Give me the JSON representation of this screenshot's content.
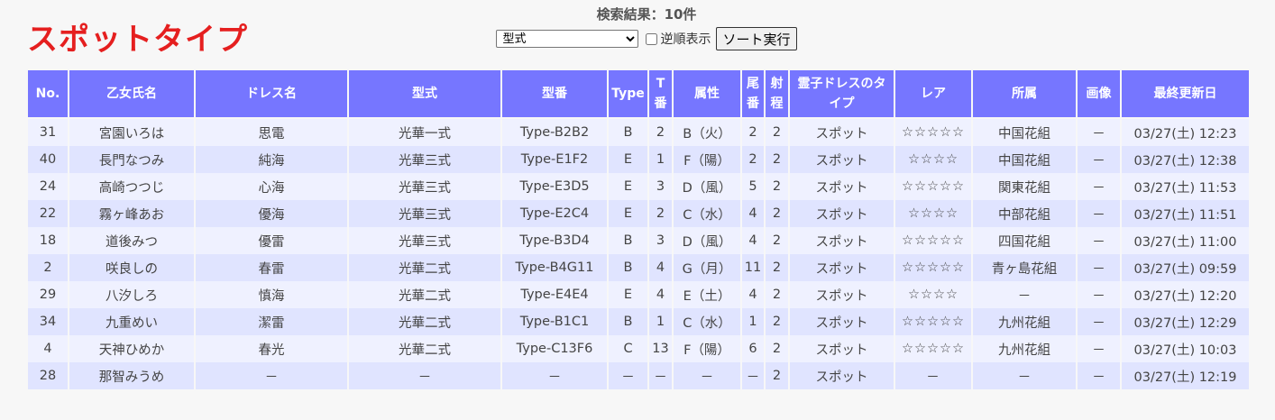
{
  "page": {
    "title": "スポットタイプ",
    "result_count": "検索結果：10件",
    "sort": {
      "selected": "型式",
      "reverse_label": "逆順表示",
      "reverse_checked": false,
      "button_label": "ソート実行"
    }
  },
  "table": {
    "headers": {
      "no": "No.",
      "name": "乙女氏名",
      "dress": "ドレス名",
      "model": "型式",
      "code": "型番",
      "type": "Type",
      "t": "T番",
      "attr": "属性",
      "tail": "尾番",
      "range": "射程",
      "dress_type": "霊子ドレスのタイプ",
      "rarity": "レア",
      "affiliation": "所属",
      "image": "画像",
      "updated": "最終更新日"
    },
    "rows": [
      {
        "no": "31",
        "name": "宮園いろは",
        "dress": "思電",
        "model": "光華一式",
        "code": "Type-B2B2",
        "type": "B",
        "t": "2",
        "attr": "B（火）",
        "tail": "2",
        "range": "2",
        "dress_type": "スポット",
        "rarity": "☆☆☆☆☆",
        "affiliation": "中国花組",
        "image": "－",
        "updated": "03/27(土) 12:23"
      },
      {
        "no": "40",
        "name": "長門なつみ",
        "dress": "純海",
        "model": "光華三式",
        "code": "Type-E1F2",
        "type": "E",
        "t": "1",
        "attr": "F（陽）",
        "tail": "2",
        "range": "2",
        "dress_type": "スポット",
        "rarity": "☆☆☆☆",
        "affiliation": "中国花組",
        "image": "－",
        "updated": "03/27(土) 12:38"
      },
      {
        "no": "24",
        "name": "高崎つつじ",
        "dress": "心海",
        "model": "光華三式",
        "code": "Type-E3D5",
        "type": "E",
        "t": "3",
        "attr": "D（風）",
        "tail": "5",
        "range": "2",
        "dress_type": "スポット",
        "rarity": "☆☆☆☆☆",
        "affiliation": "関東花組",
        "image": "－",
        "updated": "03/27(土) 11:53"
      },
      {
        "no": "22",
        "name": "霧ヶ峰あお",
        "dress": "優海",
        "model": "光華三式",
        "code": "Type-E2C4",
        "type": "E",
        "t": "2",
        "attr": "C（水）",
        "tail": "4",
        "range": "2",
        "dress_type": "スポット",
        "rarity": "☆☆☆☆",
        "affiliation": "中部花組",
        "image": "－",
        "updated": "03/27(土) 11:51"
      },
      {
        "no": "18",
        "name": "道後みつ",
        "dress": "優雷",
        "model": "光華三式",
        "code": "Type-B3D4",
        "type": "B",
        "t": "3",
        "attr": "D（風）",
        "tail": "4",
        "range": "2",
        "dress_type": "スポット",
        "rarity": "☆☆☆☆☆",
        "affiliation": "四国花組",
        "image": "－",
        "updated": "03/27(土) 11:00"
      },
      {
        "no": "2",
        "name": "咲良しの",
        "dress": "春雷",
        "model": "光華二式",
        "code": "Type-B4G11",
        "type": "B",
        "t": "4",
        "attr": "G（月）",
        "tail": "11",
        "range": "2",
        "dress_type": "スポット",
        "rarity": "☆☆☆☆☆",
        "affiliation": "青ヶ島花組",
        "image": "－",
        "updated": "03/27(土) 09:59"
      },
      {
        "no": "29",
        "name": "八汐しろ",
        "dress": "慎海",
        "model": "光華二式",
        "code": "Type-E4E4",
        "type": "E",
        "t": "4",
        "attr": "E（土）",
        "tail": "4",
        "range": "2",
        "dress_type": "スポット",
        "rarity": "☆☆☆☆",
        "affiliation": "－",
        "image": "－",
        "updated": "03/27(土) 12:20"
      },
      {
        "no": "34",
        "name": "九重めい",
        "dress": "潔雷",
        "model": "光華二式",
        "code": "Type-B1C1",
        "type": "B",
        "t": "1",
        "attr": "C（水）",
        "tail": "1",
        "range": "2",
        "dress_type": "スポット",
        "rarity": "☆☆☆☆☆",
        "affiliation": "九州花組",
        "image": "－",
        "updated": "03/27(土) 12:29"
      },
      {
        "no": "4",
        "name": "天神ひめか",
        "dress": "春光",
        "model": "光華二式",
        "code": "Type-C13F6",
        "type": "C",
        "t": "13",
        "attr": "F（陽）",
        "tail": "6",
        "range": "2",
        "dress_type": "スポット",
        "rarity": "☆☆☆☆☆",
        "affiliation": "九州花組",
        "image": "－",
        "updated": "03/27(土) 10:03"
      },
      {
        "no": "28",
        "name": "那智みうめ",
        "dress": "－",
        "model": "－",
        "code": "－",
        "type": "－",
        "t": "－",
        "attr": "－",
        "tail": "－",
        "range": "2",
        "dress_type": "スポット",
        "rarity": "－",
        "affiliation": "－",
        "image": "－",
        "updated": "03/27(土) 12:19"
      }
    ]
  },
  "colors": {
    "title": "#e51f1f",
    "header_bg": "#7676ff",
    "row_odd": "#eff1ff",
    "row_even": "#e0e4ff",
    "link": "#6666ff",
    "date": "#f04545"
  }
}
